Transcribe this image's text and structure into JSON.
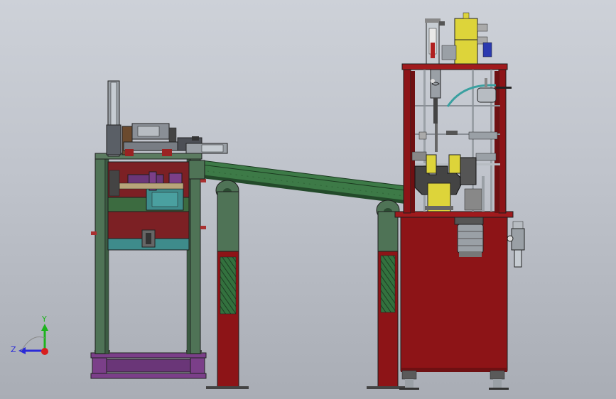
{
  "triad": {
    "y_label": "Y",
    "z_label": "Z",
    "y_color": "#1db31d",
    "z_color": "#2a2ad8",
    "x_color": "#d81e1e"
  },
  "model": {
    "components": [
      "left-press-frame",
      "inclined-conveyor",
      "conveyor-supports",
      "right-machine-frame",
      "cylinder-valve-assembly",
      "motor",
      "filter-regulator"
    ],
    "colors": {
      "frame_green": "#4f7356",
      "frame_red": "#8d1417",
      "conveyor_green": "#3d7a47",
      "cylinder_yellow": "#ddd43a",
      "purple": "#7b3f89",
      "teal": "#3e8b8b",
      "steel": "#9aa0a6"
    }
  }
}
